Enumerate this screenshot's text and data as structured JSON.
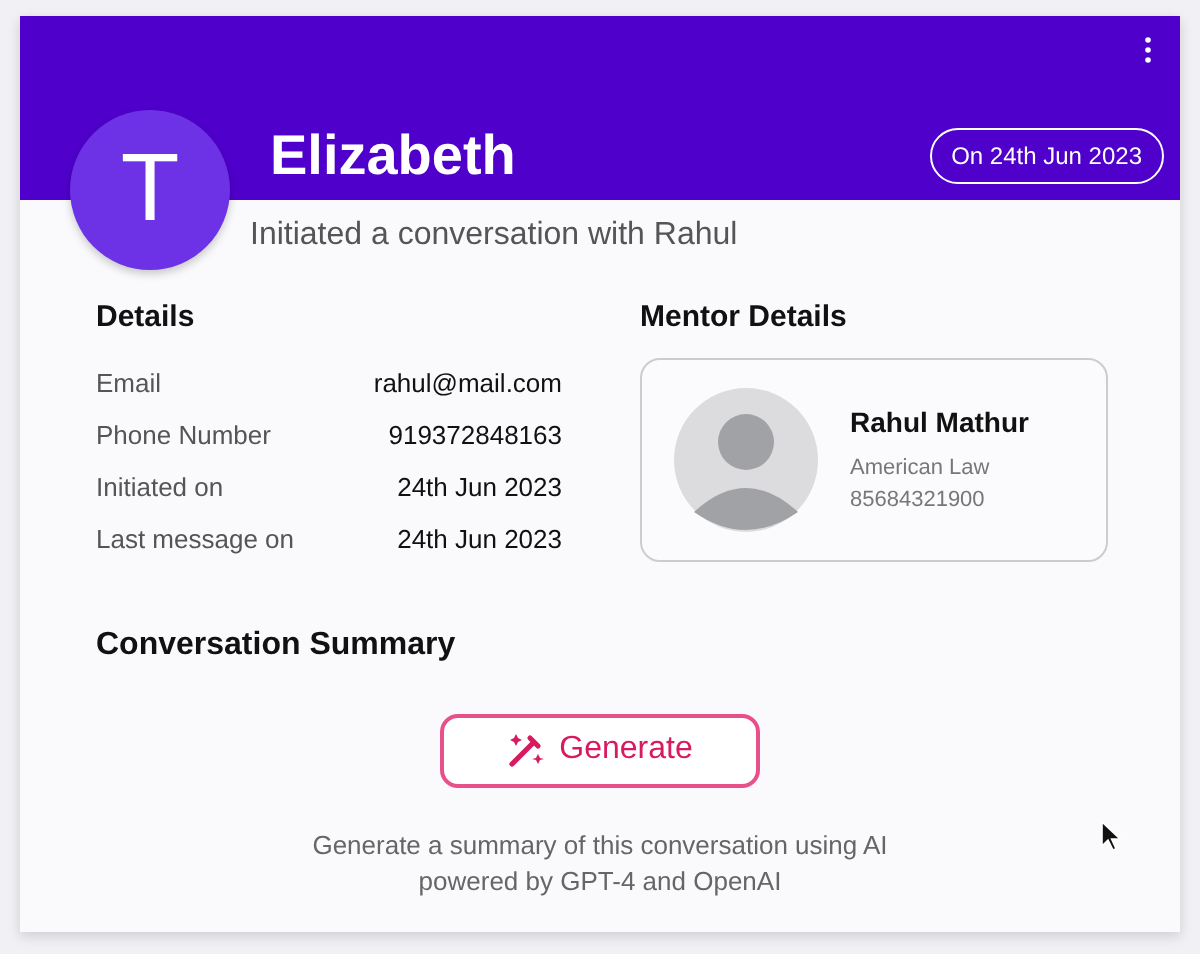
{
  "header": {
    "avatar_letter": "T",
    "name": "Elizabeth",
    "date_badge": "On 24th Jun 2023",
    "subtitle": "Initiated a conversation with Rahul"
  },
  "details": {
    "title": "Details",
    "rows": [
      {
        "label": "Email",
        "value": "rahul@mail.com"
      },
      {
        "label": "Phone Number",
        "value": "919372848163"
      },
      {
        "label": "Initiated on",
        "value": "24th Jun 2023"
      },
      {
        "label": "Last message on",
        "value": "24th Jun 2023"
      }
    ]
  },
  "mentor": {
    "title": "Mentor Details",
    "name": "Rahul Mathur",
    "field": "American Law",
    "phone": "85684321900"
  },
  "summary": {
    "title": "Conversation Summary",
    "button": "Generate",
    "description_lines": [
      "Generate a summary of this conversation using AI",
      "powered by GPT-4 and OpenAI"
    ]
  }
}
